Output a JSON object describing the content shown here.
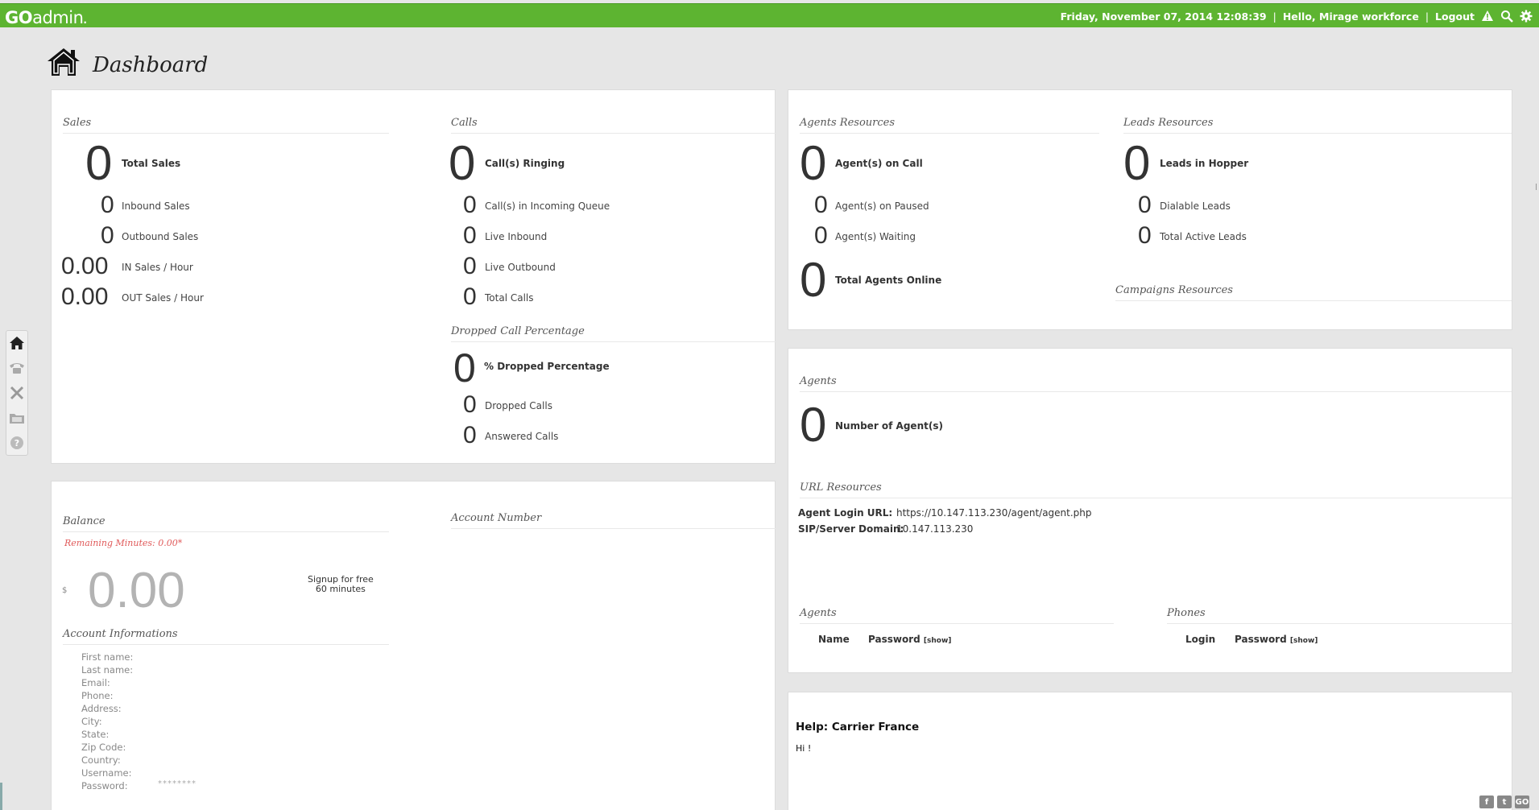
{
  "topbar": {
    "logo_go": "GO",
    "logo_admin": "admin",
    "datetime": "Friday, November 07, 2014 12:08:39",
    "greeting": "Hello, Mirage workforce",
    "logout": "Logout",
    "bg_color": "#5db431"
  },
  "page": {
    "title": "Dashboard"
  },
  "dock": {
    "icons": [
      "home-icon",
      "phone-icon",
      "tools-icon",
      "folder-icon",
      "help-icon"
    ]
  },
  "sales": {
    "title": "Sales",
    "total": {
      "value": "0",
      "label": "Total Sales"
    },
    "inbound": {
      "value": "0",
      "label": "Inbound Sales"
    },
    "outbound": {
      "value": "0",
      "label": "Outbound Sales"
    },
    "in_per_hour": {
      "value": "0.00",
      "label": "IN Sales / Hour"
    },
    "out_per_hour": {
      "value": "0.00",
      "label": "OUT Sales / Hour"
    }
  },
  "calls": {
    "title": "Calls",
    "ringing": {
      "value": "0",
      "label": "Call(s) Ringing"
    },
    "queue": {
      "value": "0",
      "label": "Call(s) in Incoming Queue"
    },
    "live_inbound": {
      "value": "0",
      "label": "Live Inbound"
    },
    "live_outbound": {
      "value": "0",
      "label": "Live Outbound"
    },
    "total": {
      "value": "0",
      "label": "Total Calls"
    }
  },
  "dropped": {
    "title": "Dropped Call Percentage",
    "percentage": {
      "value": "0",
      "label": "% Dropped Percentage"
    },
    "dropped_calls": {
      "value": "0",
      "label": "Dropped Calls"
    },
    "answered_calls": {
      "value": "0",
      "label": "Answered Calls"
    }
  },
  "agents_resources": {
    "title": "Agents Resources",
    "on_call": {
      "value": "0",
      "label": "Agent(s) on Call"
    },
    "paused": {
      "value": "0",
      "label": "Agent(s) on Paused"
    },
    "waiting": {
      "value": "0",
      "label": "Agent(s) Waiting"
    },
    "online": {
      "value": "0",
      "label": "Total Agents Online"
    }
  },
  "leads_resources": {
    "title": "Leads Resources",
    "hopper": {
      "value": "0",
      "label": "Leads in Hopper"
    },
    "dialable": {
      "value": "0",
      "label": "Dialable Leads"
    },
    "active": {
      "value": "0",
      "label": "Total Active Leads"
    }
  },
  "campaigns_resources": {
    "title": "Campaigns Resources"
  },
  "balance": {
    "title": "Balance",
    "remaining": "Remaining Minutes: 0.00*",
    "currency": "$",
    "amount": "0.00",
    "signup_line1": "Signup for free",
    "signup_line2": "60 minutes"
  },
  "account_number": {
    "title": "Account Number"
  },
  "account_info": {
    "title": "Account Informations",
    "fields": {
      "first_name": "First name:",
      "last_name": "Last name:",
      "email": "Email:",
      "phone": "Phone:",
      "address": "Address:",
      "city": "City:",
      "state": "State:",
      "zip": "Zip Code:",
      "country": "Country:",
      "username": "Username:",
      "password": "Password:"
    },
    "password_value": "********"
  },
  "agents_panel": {
    "title": "Agents",
    "count": {
      "value": "0",
      "label": "Number of Agent(s)"
    }
  },
  "url_resources": {
    "title": "URL Resources",
    "login_url_key": "Agent Login URL:",
    "login_url_value": "https://10.147.113.230/agent/agent.php",
    "sip_key": "SIP/Server Domain:",
    "sip_value": "10.147.113.230"
  },
  "agents_table": {
    "title": "Agents",
    "col_name": "Name",
    "col_password": "Password",
    "show": "[show]"
  },
  "phones_table": {
    "title": "Phones",
    "col_login": "Login",
    "col_password": "Password",
    "show": "[show]"
  },
  "help": {
    "title": "Help: Carrier France",
    "text": "Hi !"
  },
  "footer": {
    "social": [
      "f",
      "t",
      "GO"
    ]
  }
}
